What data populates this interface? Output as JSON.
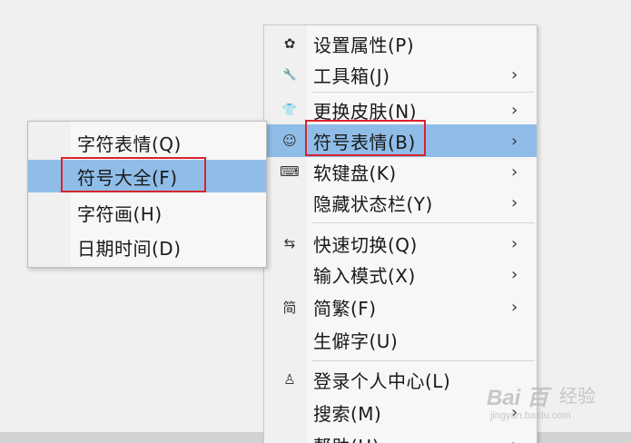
{
  "main_menu": {
    "items": [
      {
        "label": "设置属性(P)",
        "icon": "gear-icon",
        "glyph": "✿",
        "submenu": false
      },
      {
        "label": "工具箱(J)",
        "icon": "wrench-icon",
        "glyph": "🔧",
        "submenu": true
      },
      {
        "label": "更换皮肤(N)",
        "icon": "shirt-icon",
        "glyph": "👕",
        "submenu": true
      },
      {
        "label": "符号表情(B)",
        "icon": "smiley-icon",
        "glyph": "☺",
        "submenu": true
      },
      {
        "label": "软键盘(K)",
        "icon": "keyboard-icon",
        "glyph": "⌨",
        "submenu": true
      },
      {
        "label": "隐藏状态栏(Y)",
        "icon": "",
        "glyph": "",
        "submenu": true
      },
      {
        "label": "快速切换(Q)",
        "icon": "switch-arrows-icon",
        "glyph": "⇆",
        "submenu": true
      },
      {
        "label": "输入模式(X)",
        "icon": "",
        "glyph": "",
        "submenu": true
      },
      {
        "label": "简繁(F)",
        "icon": "simplified-traditional-icon",
        "glyph": "简",
        "submenu": true
      },
      {
        "label": "生僻字(U)",
        "icon": "",
        "glyph": "",
        "submenu": false
      },
      {
        "label": "登录个人中心(L)",
        "icon": "user-icon",
        "glyph": "♙",
        "submenu": false
      },
      {
        "label": "搜索(M)",
        "icon": "",
        "glyph": "",
        "submenu": true
      },
      {
        "label": "帮助(H)",
        "icon": "",
        "glyph": "",
        "submenu": true
      }
    ],
    "arrow_glyph": "›"
  },
  "sub_menu": {
    "items": [
      {
        "label": "字符表情(Q)"
      },
      {
        "label": "符号大全(F)"
      },
      {
        "label": "字符画(H)"
      },
      {
        "label": "日期时间(D)"
      }
    ]
  },
  "watermark": {
    "logo": "Bai 百",
    "text": "经验",
    "url": "jingyan.baidu.com"
  },
  "colors": {
    "highlight": "#8fbde8",
    "annotation": "#d9232a",
    "menu_bg": "#f7f7f7"
  }
}
